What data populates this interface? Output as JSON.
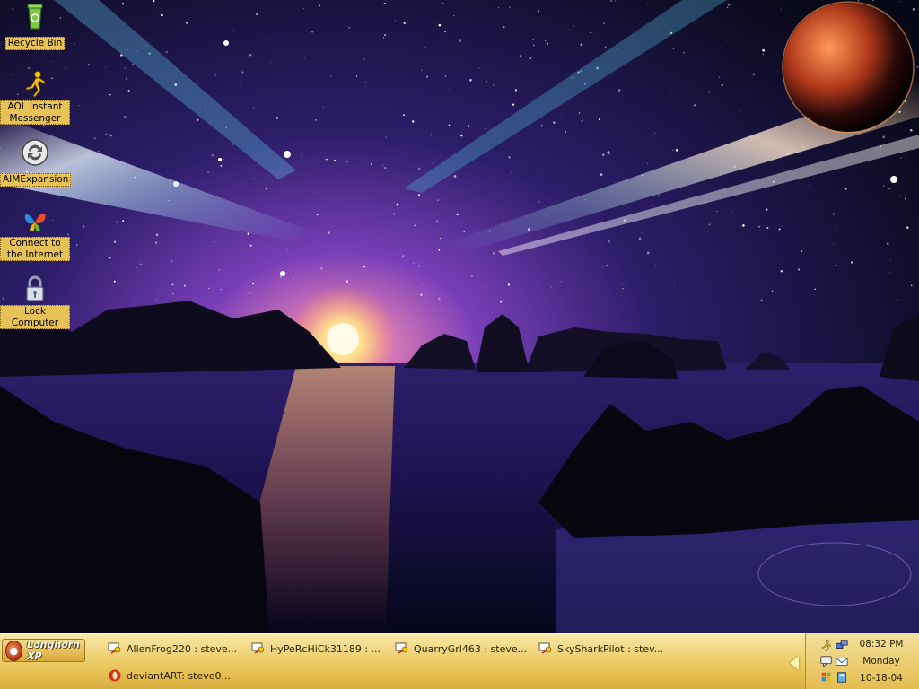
{
  "desktop_icons": [
    {
      "label": "Recycle Bin",
      "icon": "recycle-bin-icon"
    },
    {
      "label": "AOL Instant Messenger",
      "icon": "aim-running-man-icon"
    },
    {
      "label": "AIMExpansion",
      "icon": "aim-expansion-icon"
    },
    {
      "label": "Connect to the Internet",
      "icon": "msn-butterfly-icon"
    },
    {
      "label": "Lock Computer",
      "icon": "padlock-icon"
    }
  ],
  "taskbar": {
    "start_label": "Longhorn XP",
    "tasks": [
      {
        "label": "AlienFrog220 : steve...",
        "icon": "aim-chat-icon"
      },
      {
        "label": "HyPeRcHiCk31189 : ...",
        "icon": "aim-chat-icon"
      },
      {
        "label": "QuarryGrl463 : steve...",
        "icon": "aim-chat-icon"
      },
      {
        "label": "SkySharkPilot : stev...",
        "icon": "aim-chat-icon"
      },
      {
        "label": "deviantART: steve0...",
        "icon": "opera-browser-icon"
      }
    ]
  },
  "tray": {
    "time": "08:32 PM",
    "day": "Monday",
    "date": "10-18-04"
  }
}
